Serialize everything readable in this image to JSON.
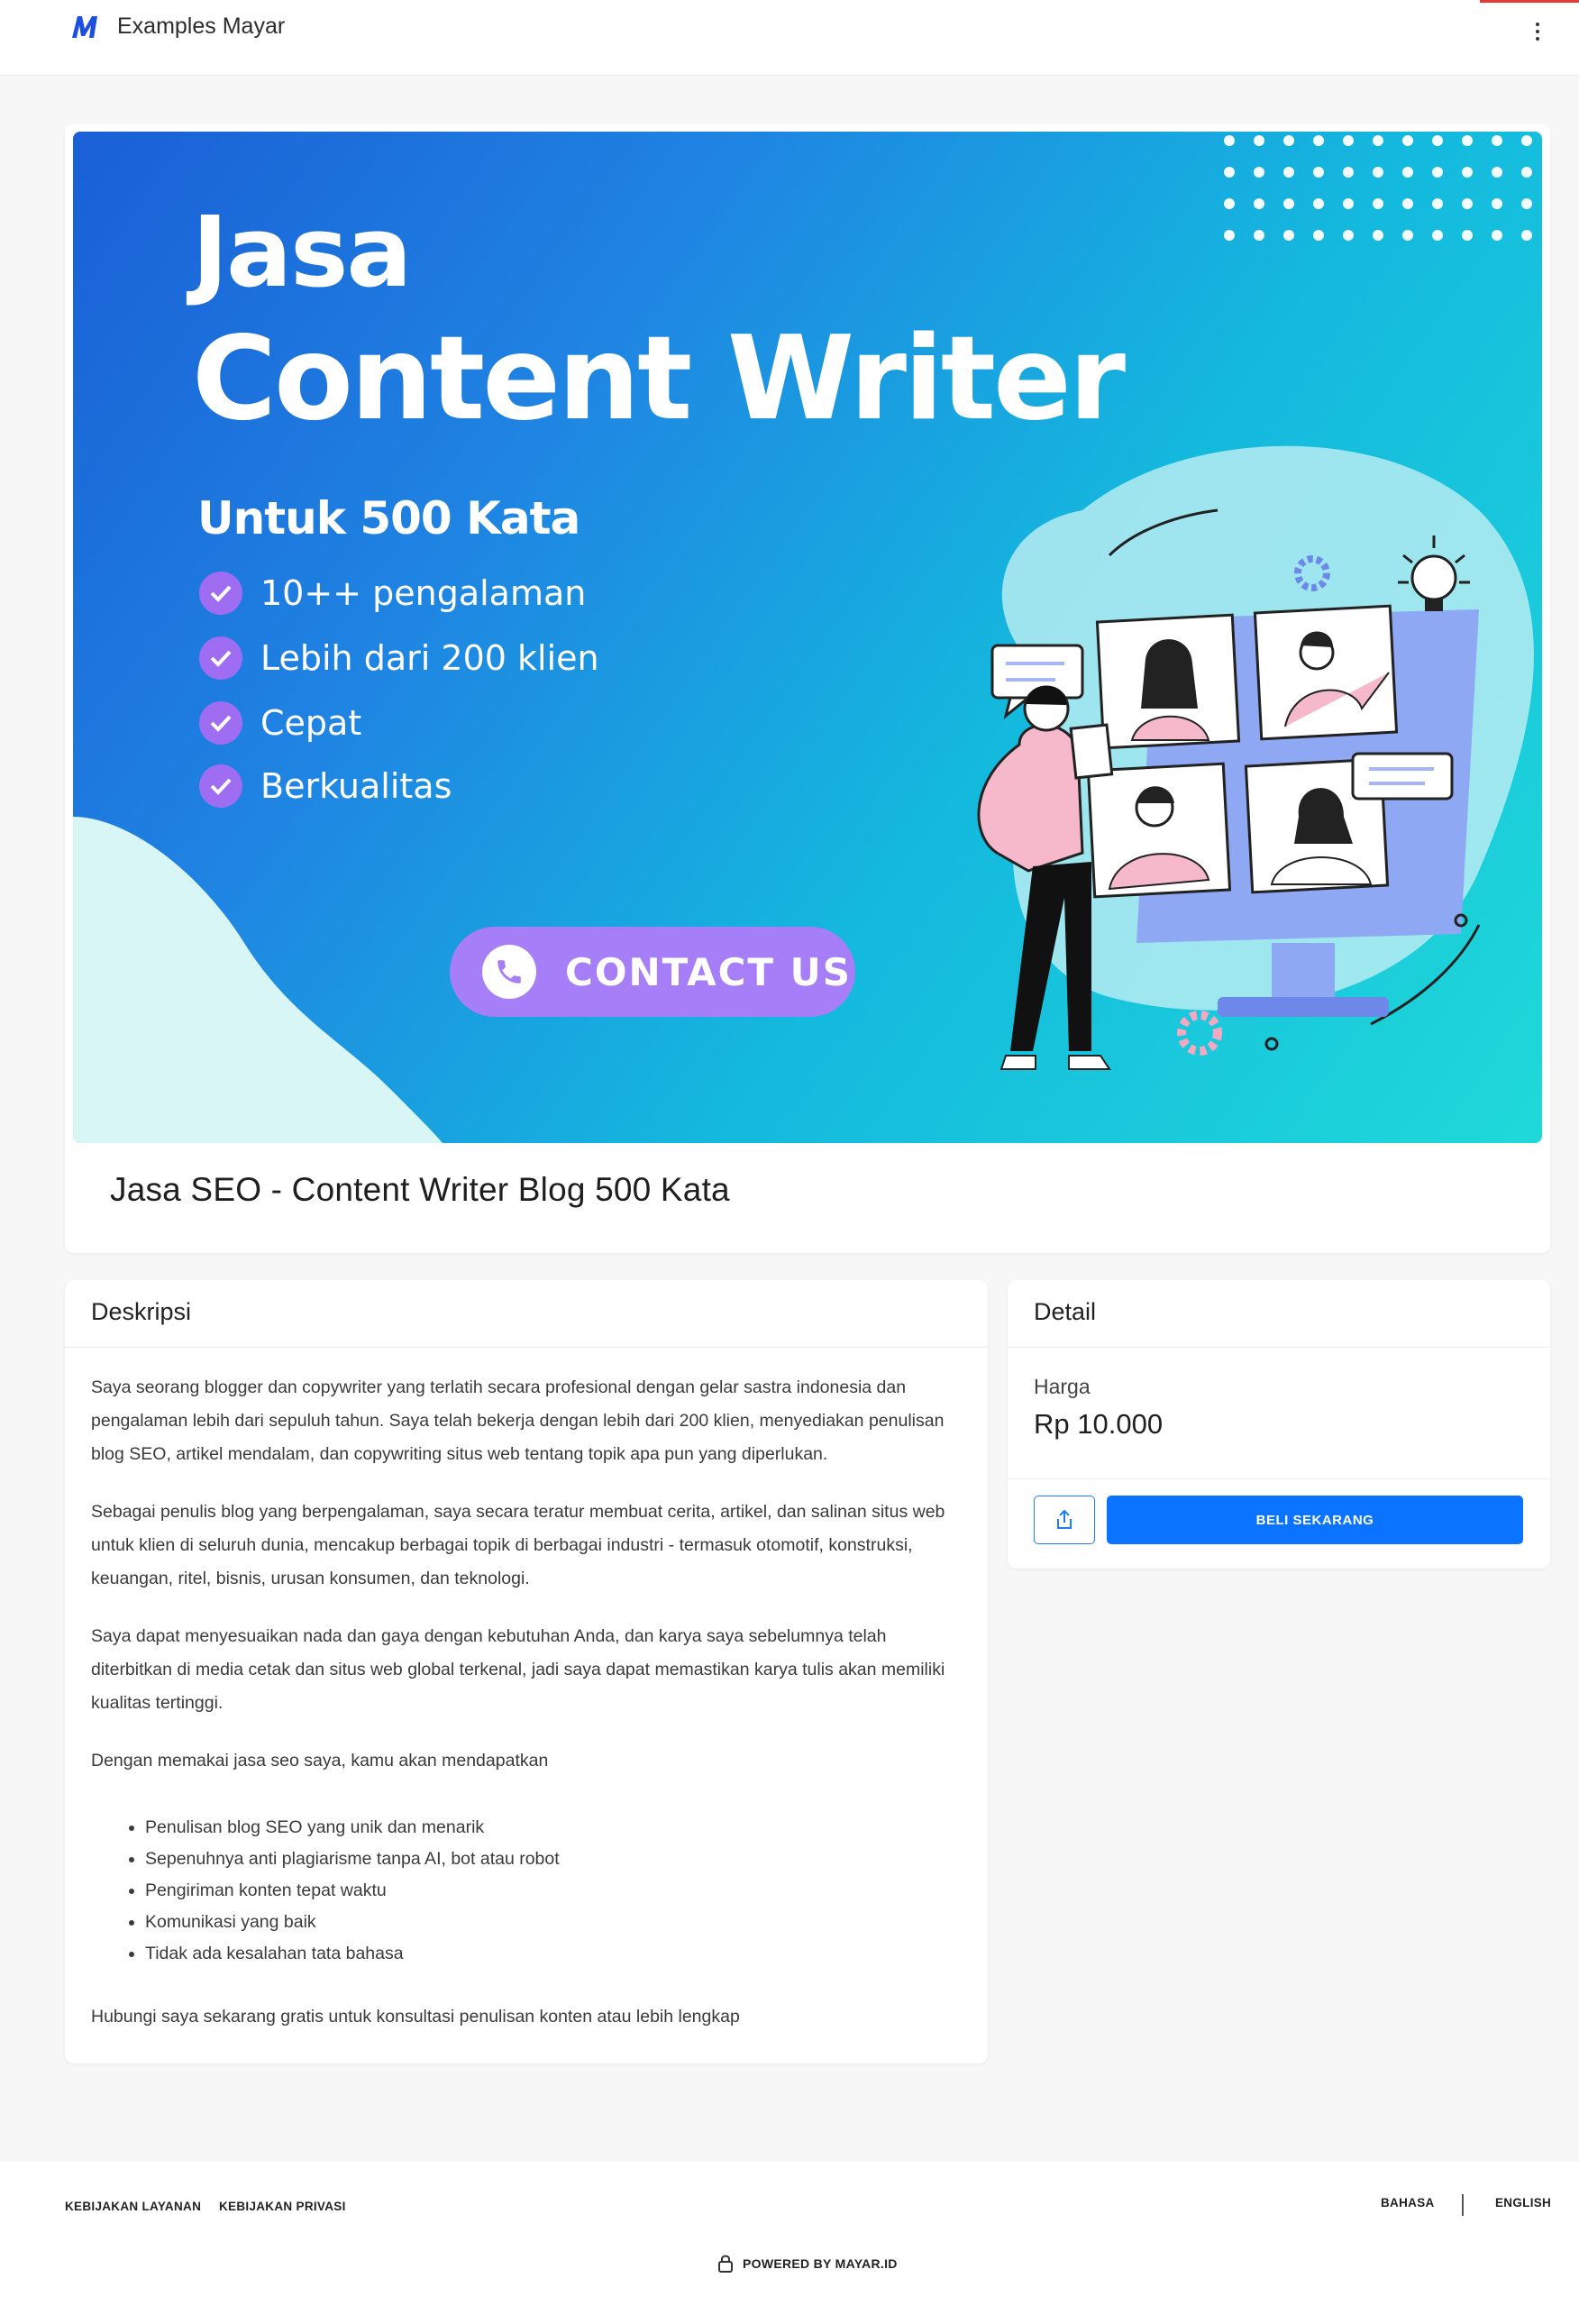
{
  "header": {
    "brand_name": "Examples Mayar",
    "logo_icon": "mayar-logo-icon",
    "menu_icon": "kebab-menu-icon"
  },
  "banner": {
    "line1": "Jasa",
    "line2": "Content Writer",
    "line3": "Untuk 500 Kata",
    "checks": [
      "10++ pengalaman",
      "Lebih dari 200 klien",
      "Cepat",
      "Berkualitas"
    ],
    "cta": "CONTACT US"
  },
  "product": {
    "title": "Jasa SEO - Content Writer Blog 500 Kata"
  },
  "description": {
    "heading": "Deskripsi",
    "paragraphs": [
      "Saya seorang blogger dan copywriter yang terlatih secara profesional dengan gelar sastra indonesia dan pengalaman lebih dari sepuluh tahun. Saya telah bekerja dengan lebih dari 200 klien, menyediakan penulisan blog SEO, artikel mendalam, dan copywriting situs web tentang topik apa pun yang diperlukan.",
      "Sebagai penulis blog yang berpengalaman, saya secara teratur membuat cerita, artikel, dan salinan situs web untuk klien di seluruh dunia, mencakup berbagai topik di berbagai industri - termasuk otomotif, konstruksi, keuangan, ritel, bisnis, urusan konsumen, dan teknologi.",
      "Saya dapat menyesuaikan nada dan gaya dengan kebutuhan Anda, dan karya saya sebelumnya telah diterbitkan di media cetak dan situs web global terkenal, jadi saya dapat memastikan karya tulis akan memiliki kualitas tertinggi.",
      "Dengan memakai jasa seo saya, kamu akan mendapatkan"
    ],
    "bullets": [
      "Penulisan blog SEO yang unik dan menarik",
      "Sepenuhnya anti plagiarisme tanpa AI, bot atau robot",
      "Pengiriman konten tepat waktu",
      "Komunikasi yang baik",
      "Tidak ada kesalahan tata bahasa"
    ],
    "closing": "Hubungi saya sekarang gratis untuk konsultasi penulisan konten atau lebih lengkap"
  },
  "detail": {
    "heading": "Detail",
    "price_label": "Harga",
    "price_value": "Rp 10.000",
    "share_icon": "share-icon",
    "buy_label": "BELI SEKARANG",
    "accent": "#0a73ff"
  },
  "footer": {
    "terms": "KEBIJAKAN LAYANAN",
    "privacy": "KEBIJAKAN PRIVASI",
    "language_label": "BAHASA",
    "language_value": "ENGLISH",
    "powered": "POWERED BY MAYAR.ID",
    "lock_icon": "lock-icon"
  }
}
